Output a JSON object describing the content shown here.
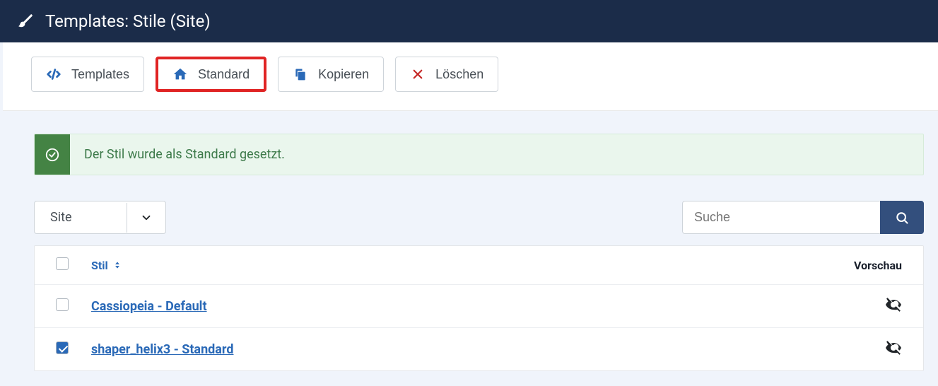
{
  "header": {
    "title": "Templates: Stile (Site)"
  },
  "toolbar": {
    "templates": "Templates",
    "standard": "Standard",
    "kopieren": "Kopieren",
    "loeschen": "Löschen"
  },
  "alert": {
    "message": "Der Stil wurde als Standard gesetzt."
  },
  "filter": {
    "selected": "Site"
  },
  "search": {
    "placeholder": "Suche"
  },
  "table": {
    "col_stil": "Stil",
    "col_vorschau": "Vorschau",
    "rows": [
      {
        "name": "Cassiopeia - Default",
        "checked": false
      },
      {
        "name": "shaper_helix3 - Standard",
        "checked": true
      }
    ]
  }
}
